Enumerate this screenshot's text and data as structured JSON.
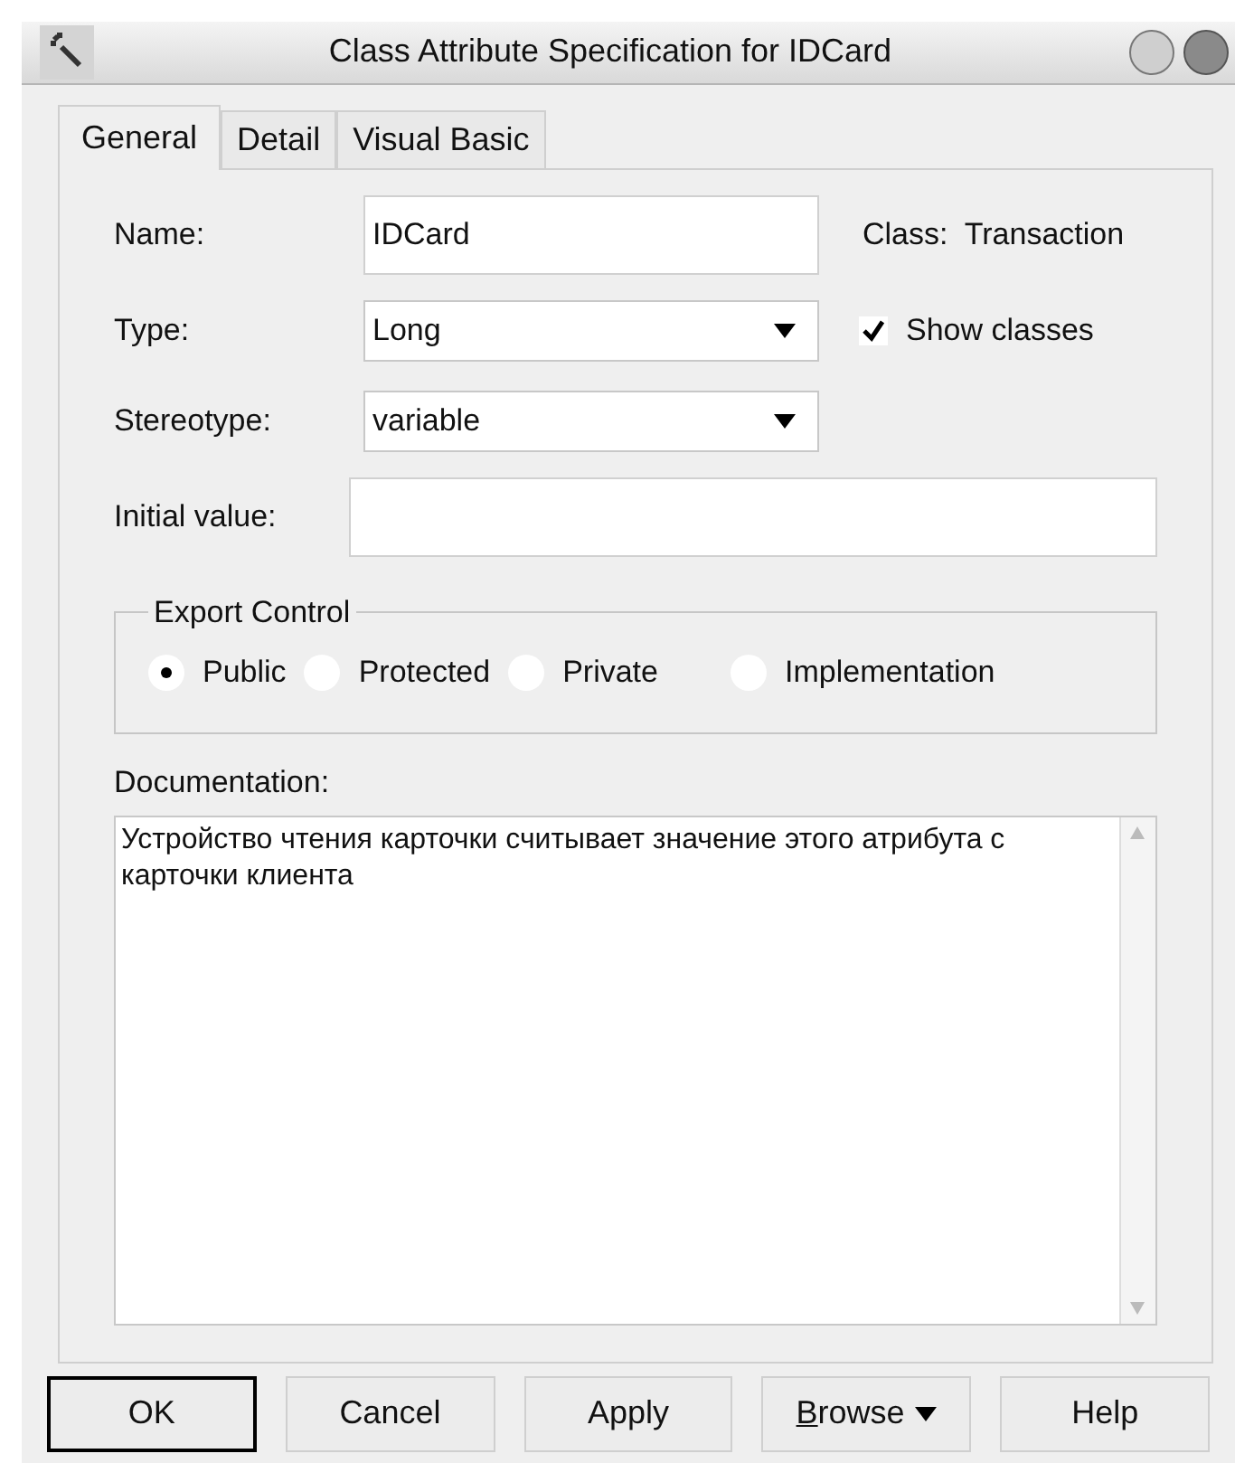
{
  "window": {
    "title": "Class Attribute Specification for IDCard"
  },
  "tabs": [
    {
      "label": "General",
      "selected": true
    },
    {
      "label": "Detail",
      "selected": false
    },
    {
      "label": "Visual Basic",
      "selected": false
    }
  ],
  "name": {
    "label": "Name:",
    "value": "IDCard"
  },
  "class_label": "Class:  Transaction",
  "type": {
    "label": "Type:",
    "value": "Long"
  },
  "show_classes": {
    "label": "Show classes",
    "checked": true
  },
  "stereotype": {
    "label": "Stereotype:",
    "value": "variable"
  },
  "initial_value": {
    "label": "Initial value:"
  },
  "export_control": {
    "title": "Export Control",
    "options": [
      {
        "label": "Public",
        "selected": true
      },
      {
        "label": "Protected",
        "selected": false
      },
      {
        "label": "Private",
        "selected": false
      },
      {
        "label": "Implementation",
        "selected": false
      }
    ]
  },
  "documentation": {
    "label": "Documentation:",
    "value": "Устройство чтения карточки считывает значение этого атрибута с карточки клиента"
  },
  "buttons": [
    {
      "label": "OK",
      "default": true,
      "underline_first": false,
      "menu": false
    },
    {
      "label": "Cancel",
      "default": false,
      "underline_first": false,
      "menu": false
    },
    {
      "label": "Apply",
      "default": false,
      "underline_first": false,
      "menu": false
    },
    {
      "label": "Browse",
      "default": false,
      "underline_first": true,
      "menu": true
    },
    {
      "label": "Help",
      "default": false,
      "underline_first": false,
      "menu": false
    }
  ]
}
